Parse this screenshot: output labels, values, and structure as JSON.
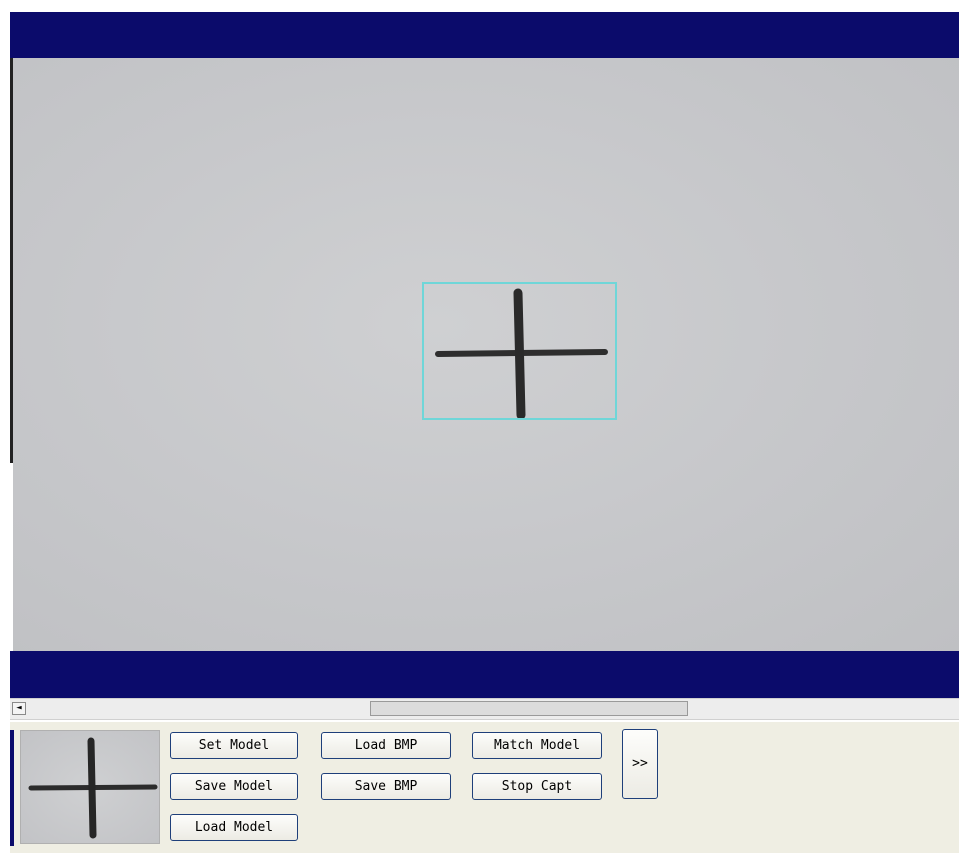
{
  "buttons": {
    "set_model": "Set Model",
    "save_model": "Save Model",
    "load_model": "Load Model",
    "load_bmp": "Load BMP",
    "save_bmp": "Save BMP",
    "match_model": "Match Model",
    "stop_capt": "Stop Capt",
    "more": ">>"
  },
  "scrollbar": {
    "left_arrow": "◄"
  },
  "colors": {
    "title_bar": "#0b0b6b",
    "panel_bg": "#efeee3",
    "roi_box": "#6fd6d8",
    "button_border": "#1e3f7a"
  },
  "icons": {
    "scroll_left": "left-arrow-icon",
    "expand": "double-chevron-icon"
  }
}
